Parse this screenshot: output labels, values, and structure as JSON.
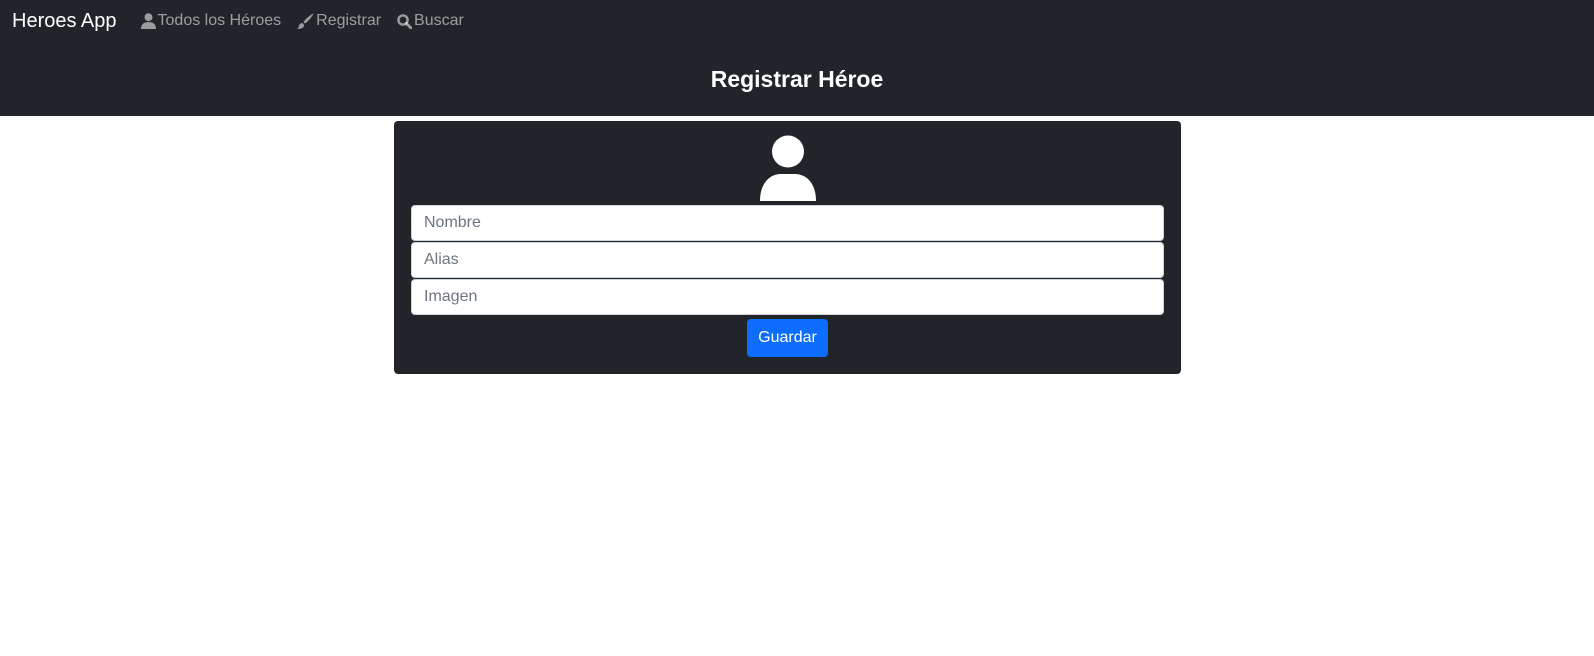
{
  "navbar": {
    "brand": "Heroes App",
    "links": [
      {
        "label": "Todos los Héroes",
        "icon": "user-icon"
      },
      {
        "label": "Registrar",
        "icon": "brush-icon"
      },
      {
        "label": "Buscar",
        "icon": "search-icon"
      }
    ]
  },
  "header": {
    "title": "Registrar Héroe"
  },
  "form": {
    "avatar_icon": "user-avatar-icon",
    "fields": [
      {
        "placeholder": "Nombre",
        "value": ""
      },
      {
        "placeholder": "Alias",
        "value": ""
      },
      {
        "placeholder": "Imagen",
        "value": ""
      }
    ],
    "submit_label": "Guardar"
  },
  "colors": {
    "dark_bg": "#212529",
    "primary": "#0d6efd",
    "nav_link": "rgba(255,255,255,0.55)"
  }
}
